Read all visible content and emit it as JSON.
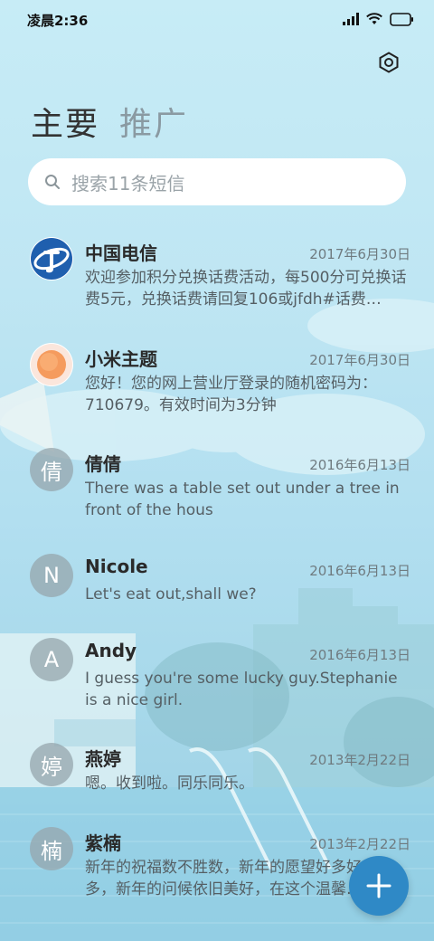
{
  "status_bar": {
    "time": "凌晨2:36"
  },
  "tabs": [
    {
      "label": "主要",
      "active": true
    },
    {
      "label": "推广",
      "active": false
    }
  ],
  "search": {
    "placeholder": "搜索11条短信"
  },
  "messages": [
    {
      "sender": "中国电信",
      "date": "2017年6月30日",
      "preview": "欢迎参加积分兑换话费活动，每500分可兑换话费5元，兑换话费请回复106或jfdh#话费…",
      "avatar_letter": "",
      "avatar_icon": "china-telecom-logo"
    },
    {
      "sender": "小米主题",
      "date": "2017年6月30日",
      "preview": "您好！您的网上营业厅登录的随机密码为：710679。有效时间为3分钟",
      "avatar_letter": "",
      "avatar_icon": "xiaomi-theme-logo"
    },
    {
      "sender": "倩倩",
      "date": "2016年6月13日",
      "preview": "There was a table set out under a tree in front of the hous",
      "avatar_letter": "倩"
    },
    {
      "sender": "Nicole",
      "date": "2016年6月13日",
      "preview": "Let's eat out,shall we?",
      "avatar_letter": "N"
    },
    {
      "sender": "Andy",
      "date": "2016年6月13日",
      "preview": "I guess you're some lucky guy.Stephanie is a nice girl.",
      "avatar_letter": "A"
    },
    {
      "sender": "燕婷",
      "date": "2013年2月22日",
      "preview": "嗯。收到啦。同乐同乐。",
      "avatar_letter": "婷"
    },
    {
      "sender": "紫楠",
      "date": "2013年2月22日",
      "preview": "新年的祝福数不胜数，新年的愿望好多好多，新年的问候依旧美好，在这个温馨的时刻…",
      "avatar_letter": "楠"
    }
  ],
  "fab": {
    "icon": "plus-icon"
  },
  "colors": {
    "accent": "#2f89c6"
  }
}
